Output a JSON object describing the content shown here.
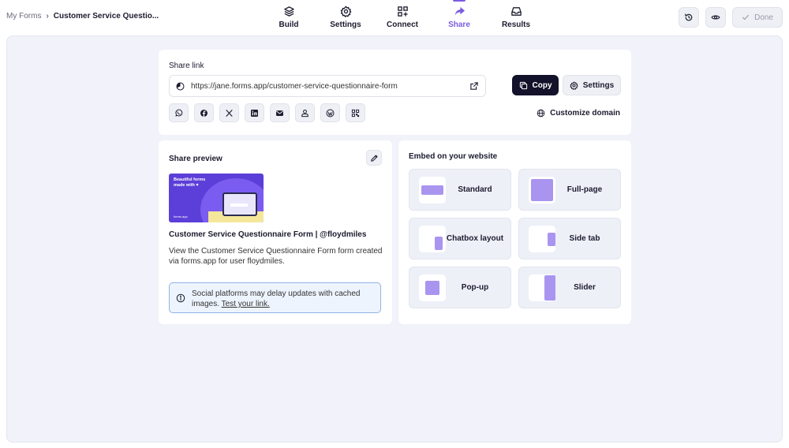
{
  "breadcrumb": {
    "root": "My Forms",
    "separator": "›",
    "current": "Customer Service Questio..."
  },
  "tabs": [
    {
      "label": "Build",
      "icon": "layers-icon",
      "active": false
    },
    {
      "label": "Settings",
      "icon": "gear-icon",
      "active": false
    },
    {
      "label": "Connect",
      "icon": "grid-plus-icon",
      "active": false
    },
    {
      "label": "Share",
      "icon": "share-arrow-icon",
      "active": true
    },
    {
      "label": "Results",
      "icon": "inbox-icon",
      "active": false
    }
  ],
  "top_actions": {
    "history_icon": "history-icon",
    "preview_icon": "eye-icon",
    "done_label": "Done"
  },
  "share_link": {
    "title": "Share link",
    "url": "https://jane.forms.app/customer-service-questionnaire-form",
    "copy_label": "Copy",
    "settings_label": "Settings",
    "socials": [
      "whatsapp-icon",
      "facebook-icon",
      "x-icon",
      "linkedin-icon",
      "email-icon",
      "user-icon",
      "wordpress-icon",
      "qr-code-icon"
    ],
    "customize_domain_label": "Customize domain"
  },
  "share_preview": {
    "title": "Share preview",
    "image_tagline": "Beautiful forms made with ♥",
    "image_logo": "forms.app",
    "heading": "Customer Service Questionnaire Form | @floydmiles",
    "description": "View the Customer Service Questionnaire Form form created via forms.app for user floydmiles.",
    "note_text": "Social platforms may delay updates with cached images.",
    "note_link": "Test your link."
  },
  "embed": {
    "title": "Embed on your website",
    "options": [
      {
        "label": "Standard"
      },
      {
        "label": "Full-page"
      },
      {
        "label": "Chatbox layout"
      },
      {
        "label": "Side tab"
      },
      {
        "label": "Pop-up"
      },
      {
        "label": "Slider"
      }
    ]
  },
  "colors": {
    "accent": "#7c5ce0",
    "dark_button": "#12122a",
    "canvas": "#f1f2fa",
    "thumb_fill": "#a995f0"
  }
}
